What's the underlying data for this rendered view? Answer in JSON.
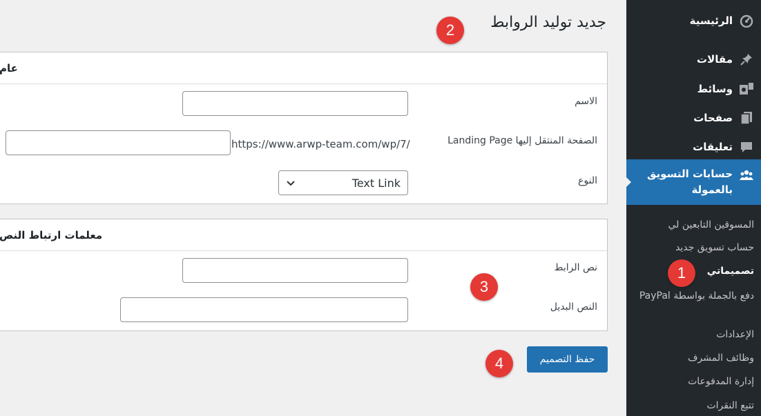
{
  "page": {
    "title": "جديد توليد الروابط"
  },
  "sidebar": {
    "menu": [
      {
        "label": "الرئيسية",
        "icon": "dashboard-icon"
      },
      {
        "label": "مقالات",
        "icon": "pin-icon"
      },
      {
        "label": "وسائط",
        "icon": "media-icon"
      },
      {
        "label": "صفحات",
        "icon": "pages-icon"
      },
      {
        "label": "تعليقات",
        "icon": "comments-icon"
      },
      {
        "label": "حسابات التسويق بالعمولة",
        "icon": "affiliates-icon"
      }
    ],
    "submenu": [
      "المسوقين التابعين لي",
      "حساب تسويق جديد",
      "تصميماتي",
      "دفع بالجملة بواسطة PayPal",
      "الإعدادات",
      "وظائف المشرف",
      "إدارة المدفوعات",
      "تتبع النقرات"
    ],
    "current_submenu": "تصميماتي"
  },
  "general_panel": {
    "heading": "عام",
    "name_label": "الاسم",
    "name_value": "",
    "landing_label": "الصفحة المنتقل إليها Landing Page",
    "landing_prefix": "https://www.arwp-team.com/wp/7/",
    "landing_value": "",
    "type_label": "النوع",
    "type_value": "Text Link"
  },
  "text_panel": {
    "heading": "معلمات ارتباط النص",
    "link_text_label": "نص الرابط",
    "link_text_value": "",
    "alt_text_label": "النص البديل",
    "alt_text_value": ""
  },
  "save_label": "حفظ التصميم",
  "badges": [
    "1",
    "2",
    "3",
    "4"
  ],
  "colors": {
    "sidebar_bg": "#23282d",
    "accent": "#2271b1",
    "badge": "#e53935",
    "page_bg": "#f0f0f1"
  }
}
